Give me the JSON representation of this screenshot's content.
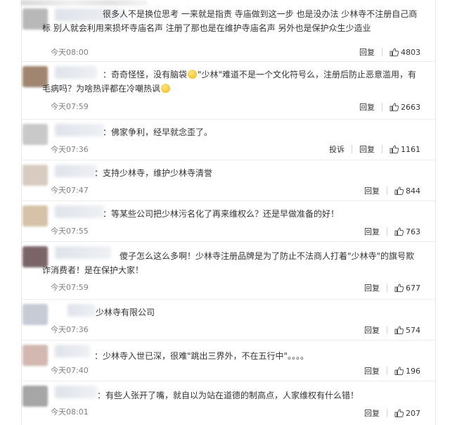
{
  "comments": [
    {
      "text": "很多人不是换位思考 一来就是指责 寺庙做到这一步 也是没办法 少林寺不注册自己商标 别人就会利用来损坏寺庙名声 注册了那也是在维护寺庙名声 另外也是保护众生少造业",
      "time": "今天08:00",
      "reply_label": "回复",
      "likes": "4803",
      "avatar_color": "#b8b8b8"
    },
    {
      "text": "：奇奇怪怪，没有脑袋",
      "text_b": "\"少林\"难道不是一个文化符号么，注册后防止恶意滥用，有毛病吗？为啥热评都在冷嘲热讽",
      "time": "今天07:59",
      "reply_label": "回复",
      "likes": "2663",
      "avatar_color": "#a08670"
    },
    {
      "text": "：佛家争利，经早就念歪了。",
      "time": "今天07:36",
      "report_label": "投诉",
      "reply_label": "回复",
      "likes": "1161",
      "avatar_color": "#c9c9c9"
    },
    {
      "text": "：支持少林寺，维护少林寺清誉",
      "time": "今天07:47",
      "reply_label": "回复",
      "likes": "844",
      "avatar_color": "#d8ccc0"
    },
    {
      "text": "：等某些公司把少林污名化了再来维权么？还是早做准备的好！",
      "time": "今天07:55",
      "reply_label": "回复",
      "likes": "763",
      "avatar_color": "#d6c2a8"
    },
    {
      "text": "傻子怎么这么多啊！少林寺注册品牌是为了防止不法商人打着\"少林寺\"的旗号欺诈消费者！是在保护大家！",
      "time": "今天07:59",
      "reply_label": "回复",
      "likes": "677",
      "avatar_color": "#7a6468"
    },
    {
      "text": "少林寺有限公司",
      "time": "今天07:36",
      "reply_label": "回复",
      "likes": "574",
      "avatar_color": "#c7cbd6"
    },
    {
      "text": "：少林寺入世已深，很难\"跳出三界外，不在五行中\"。。。。",
      "time": "今天07:40",
      "reply_label": "回复",
      "likes": "196",
      "avatar_color": "#d2b8b0"
    },
    {
      "text": "：有些人张开了嘴，就自以为站在道德的制高点，人家维权有什么错！",
      "time": "今天08:01",
      "reply_label": "回复",
      "likes": "207",
      "avatar_color": "#a6a6a6"
    }
  ],
  "icons": {
    "like": "thumb-up-icon",
    "emoji": "smile-emoji-icon"
  }
}
